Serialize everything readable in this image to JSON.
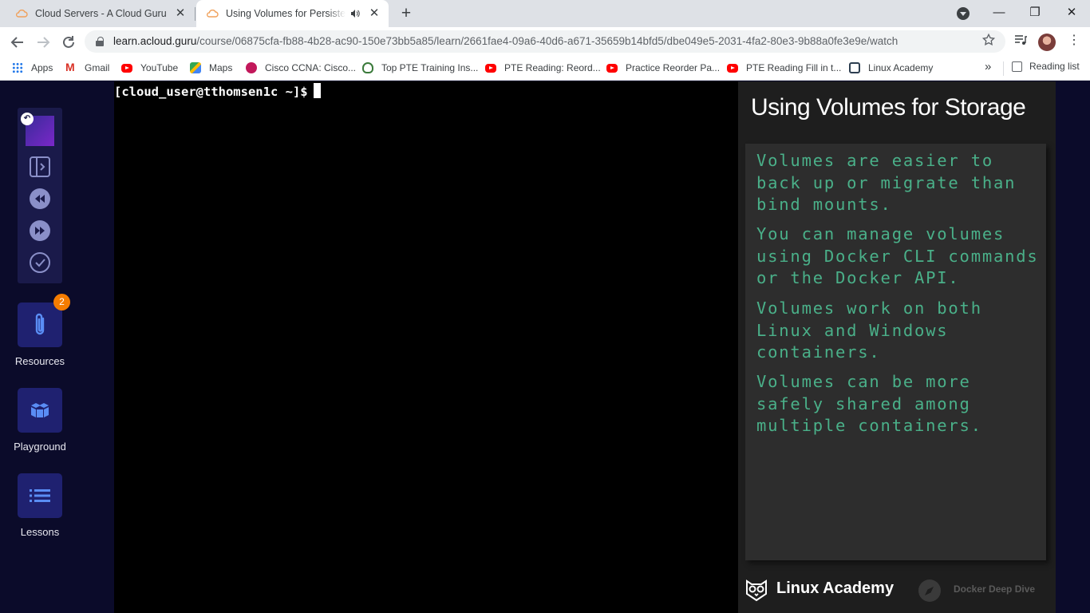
{
  "browser": {
    "tabs": [
      {
        "title": "Cloud Servers - A Cloud Guru",
        "active": false
      },
      {
        "title": "Using Volumes for Persistent",
        "active": true
      }
    ],
    "close_glyph": "✕",
    "new_tab_glyph": "+",
    "window_controls": {
      "minimize": "—",
      "restore": "❐",
      "close": "✕"
    },
    "url_host": "learn.acloud.guru",
    "url_path": "/course/06875cfa-fb88-4b28-ac90-150e73bb5a85/learn/2661fae4-09a6-40d6-a671-35659b14bfd5/dbe049e5-2031-4fa2-80e3-9b88a0fe3e9e/watch",
    "bookmarks": [
      {
        "label": "Apps",
        "icon": "apps-grid-icon"
      },
      {
        "label": "Gmail",
        "icon": "gmail-icon"
      },
      {
        "label": "YouTube",
        "icon": "youtube-icon"
      },
      {
        "label": "Maps",
        "icon": "maps-icon"
      },
      {
        "label": "Cisco CCNA: Cisco...",
        "icon": "cisco-icon"
      },
      {
        "label": "Top PTE Training Ins...",
        "icon": "pte-icon"
      },
      {
        "label": "PTE Reading: Reord...",
        "icon": "youtube-icon"
      },
      {
        "label": "Practice Reorder Pa...",
        "icon": "youtube-icon"
      },
      {
        "label": "PTE Reading Fill in t...",
        "icon": "youtube-icon"
      },
      {
        "label": "Linux Academy",
        "icon": "linux-academy-icon"
      }
    ],
    "bookmarks_more": "»",
    "reading_list": "Reading list"
  },
  "sidebar": {
    "resources_badge": "2",
    "items": [
      {
        "label": "Resources",
        "icon": "paperclip-icon"
      },
      {
        "label": "Playground",
        "icon": "cubes-icon"
      },
      {
        "label": "Lessons",
        "icon": "list-icon"
      }
    ]
  },
  "terminal": {
    "prompt": "[cloud_user@tthomsen1c ~]$"
  },
  "slide": {
    "title": "Using Volumes for Storage",
    "bullets": [
      "Volumes are easier to\nback up or migrate than\nbind mounts.",
      "You can manage volumes\nusing Docker CLI commands\nor the Docker API.",
      "Volumes work on both\nLinux and Windows\ncontainers.",
      "Volumes can be more\nsafely shared among\nmultiple containers."
    ],
    "footer_brand": "Linux Academy",
    "footer_course": "Docker Deep Dive"
  },
  "colors": {
    "page_bg": "#0b0b2a",
    "sidebar_button": "#1f2170",
    "slide_text": "#4ab089",
    "badge": "#f57c00"
  }
}
